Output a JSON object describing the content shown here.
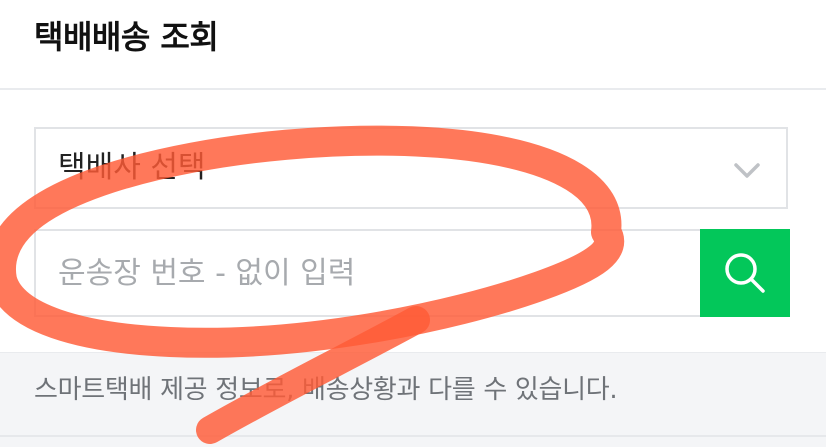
{
  "header": {
    "title": "택배배송 조회"
  },
  "carrier_select": {
    "label": "택배사 선택",
    "icon": "chevron-down-icon"
  },
  "tracking": {
    "placeholder": "운송장 번호 - 없이 입력",
    "value": ""
  },
  "search_button": {
    "icon": "search-icon",
    "color": "#03c75a"
  },
  "footer": {
    "note": "스마트택배 제공 정보로, 배송상황과 다를 수 있습니다."
  },
  "annotation": {
    "color": "#ff5a36",
    "icon": "red-marker-circle-annotation"
  }
}
